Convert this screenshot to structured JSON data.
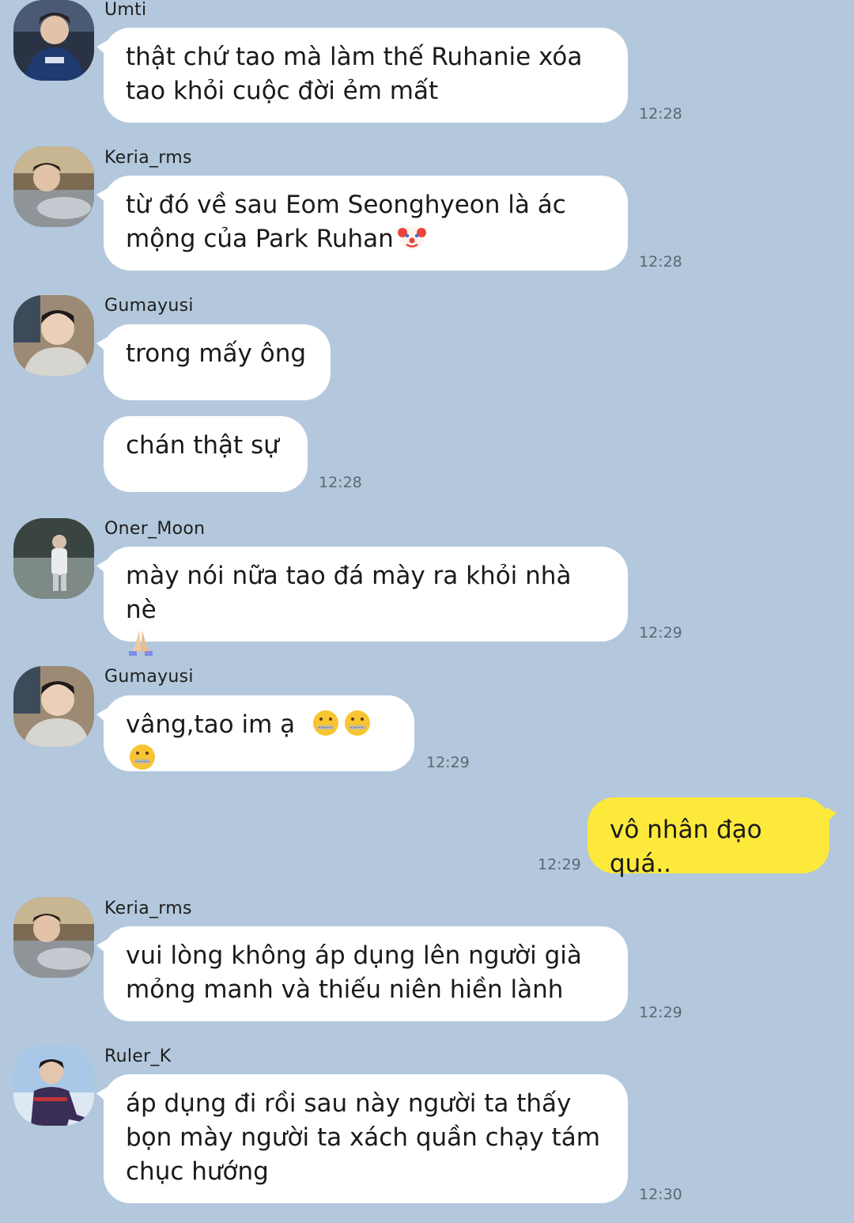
{
  "messages": [
    {
      "sender": "Umti",
      "lines": [
        "thật chứ tao mà làm thế Ruhanie xóa",
        "tao khỏi cuộc đời ẻm mất"
      ],
      "time": "12:28"
    },
    {
      "sender": "Keria_rms",
      "lines": [
        "từ đó về sau Eom Seonghyeon là ác",
        "mộng của Park Ruhan"
      ],
      "emoji": [
        "clown-face"
      ],
      "time": "12:28"
    },
    {
      "sender": "Gumayusi",
      "lines": [
        "trong mấy ông"
      ]
    },
    {
      "lines": [
        "chán thật sự"
      ],
      "time": "12:28"
    },
    {
      "sender": "Oner_Moon",
      "lines": [
        "mày nói nữa tao đá mày ra khỏi nhà nè"
      ],
      "emoji": [
        "folded-hands"
      ],
      "time": "12:29"
    },
    {
      "sender": "Gumayusi",
      "lines": [
        "vâng,tao im ạ"
      ],
      "emoji": [
        "zipper-mouth-face",
        "zipper-mouth-face",
        "zipper-mouth-face"
      ],
      "time": "12:29"
    },
    {
      "lines": [
        "vô nhân đạo quá.."
      ],
      "time": "12:29",
      "mine": true
    },
    {
      "sender": "Keria_rms",
      "lines": [
        "vui lòng không áp dụng lên người già",
        "mỏng manh và thiếu niên hiền lành"
      ],
      "time": "12:29"
    },
    {
      "sender": "Ruler_K",
      "lines": [
        "áp dụng đi rồi sau này người ta thấy",
        "bọn mày người ta xách quần chạy tám",
        "chục hướng"
      ],
      "time": "12:30"
    }
  ],
  "colors": {
    "background": "#b3c8dc",
    "incoming_bubble": "#ffffff",
    "outgoing_bubble": "#fce93c"
  }
}
